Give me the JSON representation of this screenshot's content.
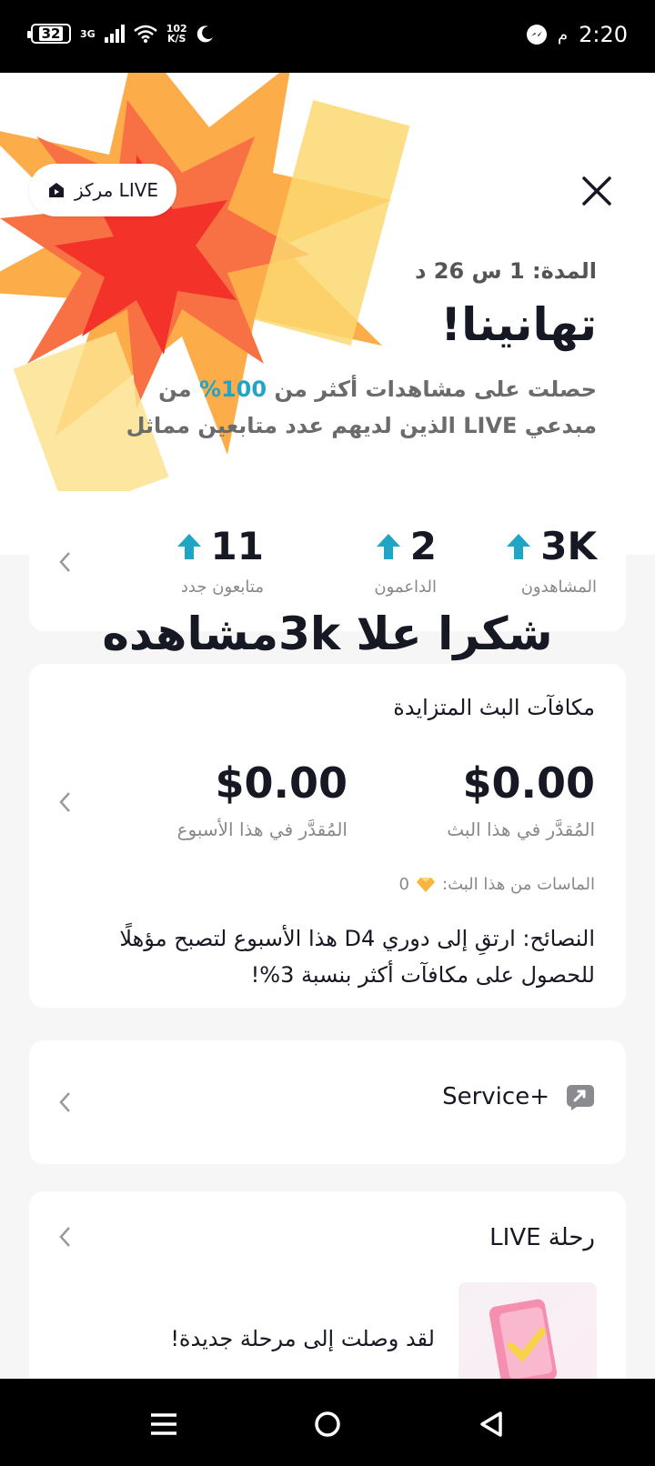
{
  "status_bar": {
    "battery": "32",
    "network": "3G",
    "speed_value": "102",
    "speed_unit": "K/S",
    "ampm": "م",
    "time": "2:20"
  },
  "header": {
    "live_center_label": "مركز LIVE",
    "close_icon": "close-icon"
  },
  "summary": {
    "duration": "المدة: 1 س 26 د",
    "title": "تهانينا!",
    "desc_prefix": "حصلت على مشاهدات أكثر من ",
    "desc_pct": "100%",
    "desc_mid": " من مبدعي ",
    "desc_live": "LIVE",
    "desc_suffix": " الذين لديهم عدد متابعين مماثل"
  },
  "stats": [
    {
      "value": "3K",
      "label": "المشاهدون"
    },
    {
      "value": "2",
      "label": "الداعمون"
    },
    {
      "value": "11",
      "label": "متابعون جدد"
    }
  ],
  "overlay_text": "شكرا علا 3kمشاهده",
  "rewards": {
    "title": "مكافآت البث المتزايدة",
    "this_stream_value": "$0.00",
    "this_stream_label": "المُقدَّر في هذا البث",
    "this_week_value": "$0.00",
    "this_week_label": "المُقدَّر في هذا الأسبوع",
    "diamonds_label": "الماسات من هذا البث:",
    "diamonds_value": "0",
    "tips": "النصائح: ارتقِ إلى دوري D4 هذا الأسبوع لتصبح مؤهلًا للحصول على مكافآت أكثر بنسبة 3%!"
  },
  "service": {
    "label": "Service+"
  },
  "journey": {
    "title": "رحلة LIVE",
    "item_text": "لقد وصلت إلى مرحلة جديدة!"
  },
  "colors": {
    "accent": "#20a5c5",
    "text": "#161823",
    "muted": "#888888",
    "background": "#f6f6f6"
  }
}
